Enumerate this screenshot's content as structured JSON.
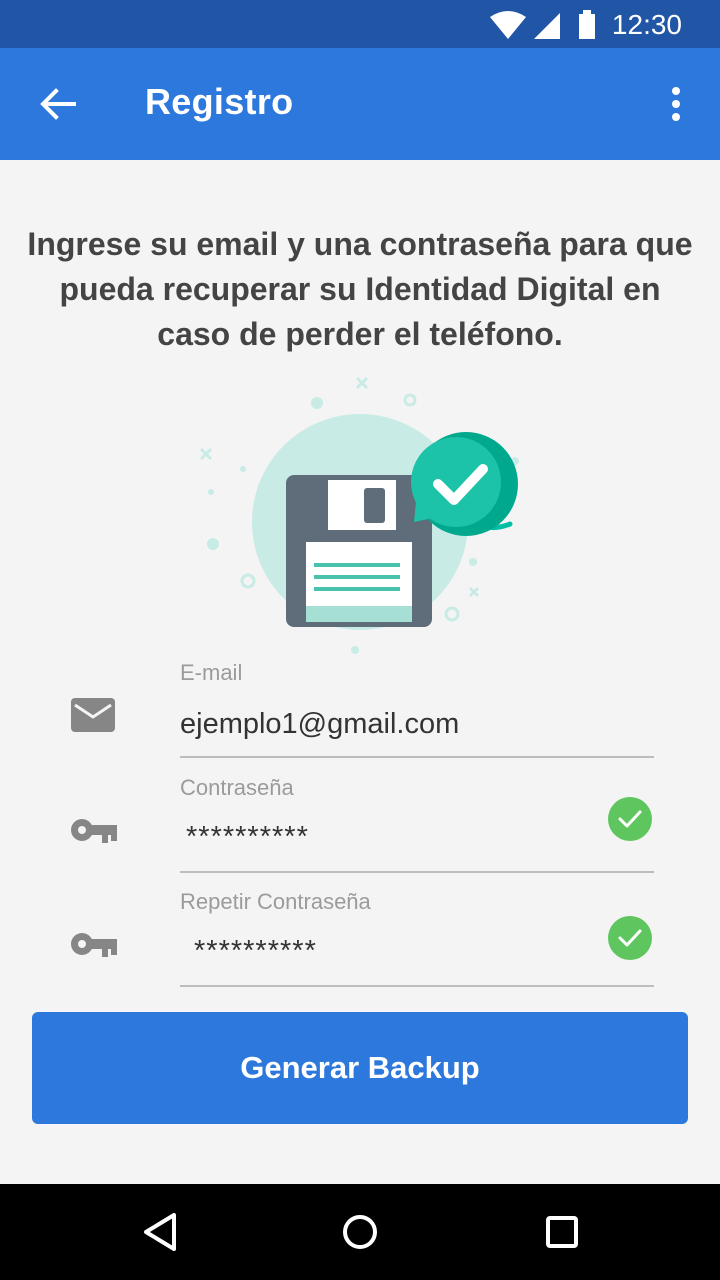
{
  "status_bar": {
    "time": "12:30",
    "icons": [
      "wifi-icon",
      "signal-icon",
      "battery-icon"
    ]
  },
  "app_bar": {
    "title": "Registro",
    "back_icon": "arrow-back-icon",
    "menu_icon": "more-vert-icon"
  },
  "intro_text": "Ingrese su email y una contraseña para que pueda recuperar su Identidad Digital en caso de perder el teléfono.",
  "illustration": "floppy-disk-check-illustration",
  "form": {
    "email": {
      "label": "E-mail",
      "value": "ejemplo1@gmail.com",
      "icon": "mail-icon"
    },
    "password": {
      "label": "Contraseña",
      "value": "**********",
      "icon": "key-icon",
      "valid": true
    },
    "repeat_password": {
      "label": "Repetir Contraseña",
      "value": "**********",
      "icon": "key-icon",
      "valid": true
    }
  },
  "primary_button": {
    "label": "Generar Backup"
  },
  "colors": {
    "primary": "#2d78dc",
    "status_bar": "#2155a6",
    "success": "#5fc65f",
    "teal": "#00bfa5"
  },
  "nav_bar": {
    "icons": [
      "back-triangle-icon",
      "home-circle-icon",
      "recents-square-icon"
    ]
  }
}
